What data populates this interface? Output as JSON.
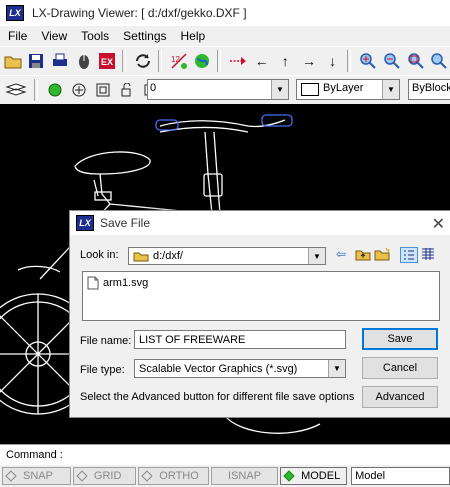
{
  "app": {
    "title": "LX-Drawing Viewer: [ d:/dxf/gekko.DXF ]",
    "logo": "LX"
  },
  "menu": [
    "File",
    "View",
    "Tools",
    "Settings",
    "Help"
  ],
  "layer": {
    "value": "0"
  },
  "color_combo": {
    "value": "ByLayer"
  },
  "linetype_combo": {
    "value": "ByBlock"
  },
  "command": {
    "label": "Command :",
    "value": ""
  },
  "status": {
    "snap": "SNAP",
    "grid": "GRID",
    "ortho": "ORTHO",
    "isnap": "ISNAP",
    "model_btn": "MODEL",
    "model_field": "Model"
  },
  "dialog": {
    "title": "Save File",
    "logo": "LX",
    "look_in_label": "Look in:",
    "look_in_value": "d:/dxf/",
    "files": [
      {
        "name": "arm1.svg"
      }
    ],
    "file_name_label": "File name:",
    "file_name_value": "LIST OF FREEWARE",
    "file_type_label": "File type:",
    "file_type_value": "Scalable Vector Graphics (*.svg)",
    "advanced_hint": "Select the Advanced button for different file save options",
    "save_button": "Save",
    "cancel_button": "Cancel",
    "advanced_button": "Advanced"
  },
  "colors": {
    "canvas": "#000000",
    "drawing_lines": "#ffffff",
    "grip_blue": "#4a6cf7",
    "model_green": "#2fb82f"
  }
}
